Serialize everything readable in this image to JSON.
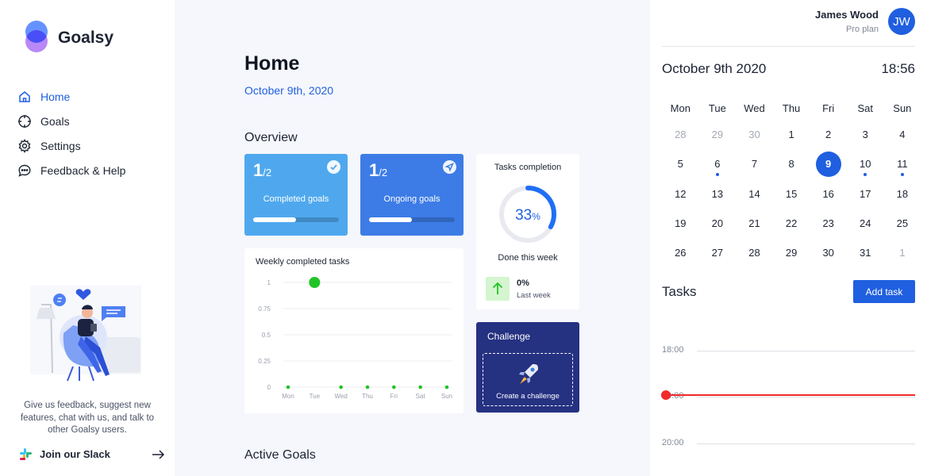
{
  "brand": {
    "name": "Goalsy"
  },
  "sidebar": {
    "items": [
      {
        "label": "Home",
        "icon": "home-icon",
        "active": true
      },
      {
        "label": "Goals",
        "icon": "target-icon"
      },
      {
        "label": "Settings",
        "icon": "gear-icon"
      },
      {
        "label": "Feedback & Help",
        "icon": "chat-icon"
      }
    ],
    "feedback_text": "Give us feedback, suggest new features, chat with us, and talk to other Goalsy users.",
    "slack_label": "Join our Slack"
  },
  "main": {
    "title": "Home",
    "date": "October 9th, 2020",
    "overview_title": "Overview",
    "active_goals_title": "Active Goals",
    "completed_card": {
      "fraction_num": "1",
      "fraction_den": "/2",
      "label": "Completed goals",
      "progress": 0.5,
      "color": "#4fa8ee"
    },
    "ongoing_card": {
      "fraction_num": "1",
      "fraction_den": "/2",
      "label": "Ongoing goals",
      "progress": 0.5,
      "color": "#3d7ce6"
    },
    "tasks_completion": {
      "title": "Tasks completion",
      "percent": 33,
      "percent_number": "33",
      "percent_sign": "%",
      "done_label": "Done this week",
      "last_week_value": "0%",
      "last_week_label": "Last week"
    },
    "challenge": {
      "title": "Challenge",
      "button_label": "Create a challenge"
    }
  },
  "chart_data": {
    "type": "scatter",
    "title": "Weekly completed tasks",
    "categories": [
      "Mon",
      "Tue",
      "Wed",
      "Thu",
      "Fri",
      "Sat",
      "Sun"
    ],
    "values": [
      0,
      1,
      0,
      0,
      0,
      0,
      0
    ],
    "y_ticks": [
      "0",
      "0.25",
      "0.5",
      "0.75",
      "1"
    ],
    "ylim": [
      0,
      1
    ],
    "grid": true,
    "highlight_color": "#20c427",
    "point_color": "#20c427"
  },
  "user": {
    "name": "James Wood",
    "plan": "Pro plan",
    "initials": "JW"
  },
  "calendar": {
    "date": "October 9th 2020",
    "time": "18:56",
    "weekdays": [
      "Mon",
      "Tue",
      "Wed",
      "Thu",
      "Fri",
      "Sat",
      "Sun"
    ],
    "weeks": [
      [
        {
          "d": "28",
          "m": true
        },
        {
          "d": "29",
          "m": true
        },
        {
          "d": "30",
          "m": true
        },
        {
          "d": "1"
        },
        {
          "d": "2"
        },
        {
          "d": "3"
        },
        {
          "d": "4"
        }
      ],
      [
        {
          "d": "5"
        },
        {
          "d": "6",
          "dot": true
        },
        {
          "d": "7"
        },
        {
          "d": "8"
        },
        {
          "d": "9",
          "sel": true
        },
        {
          "d": "10",
          "dot": true
        },
        {
          "d": "11",
          "dot": true
        }
      ],
      [
        {
          "d": "12"
        },
        {
          "d": "13"
        },
        {
          "d": "14"
        },
        {
          "d": "15"
        },
        {
          "d": "16"
        },
        {
          "d": "17"
        },
        {
          "d": "18"
        }
      ],
      [
        {
          "d": "19"
        },
        {
          "d": "20"
        },
        {
          "d": "21"
        },
        {
          "d": "22"
        },
        {
          "d": "23"
        },
        {
          "d": "24"
        },
        {
          "d": "25"
        }
      ],
      [
        {
          "d": "26"
        },
        {
          "d": "27"
        },
        {
          "d": "28"
        },
        {
          "d": "29"
        },
        {
          "d": "30"
        },
        {
          "d": "31"
        },
        {
          "d": "1",
          "m": true
        }
      ]
    ]
  },
  "tasks": {
    "title": "Tasks",
    "add_label": "Add task",
    "timeline": [
      "18:00",
      "19:00",
      "20:00"
    ]
  }
}
